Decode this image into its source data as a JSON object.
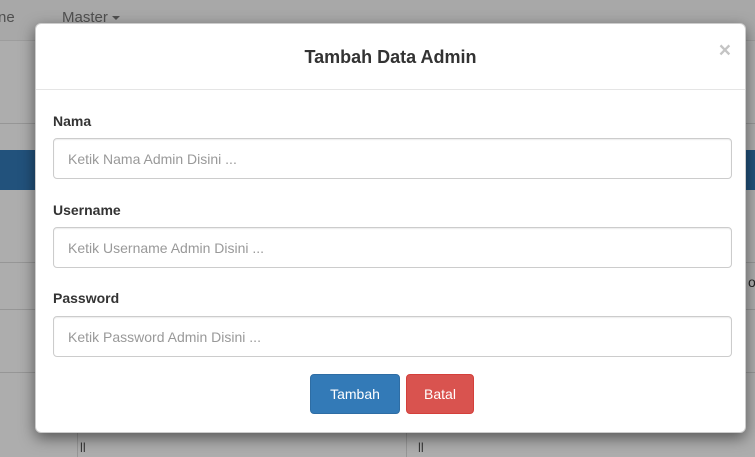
{
  "background": {
    "nav_fragment": "ne",
    "nav_master": "Master",
    "table_cell_1": "ll",
    "table_cell_2": "ll",
    "edge_fragment": "o"
  },
  "modal": {
    "title": "Tambah Data Admin",
    "close": "×",
    "fields": {
      "nama": {
        "label": "Nama",
        "placeholder": "Ketik Nama Admin Disini ...",
        "value": ""
      },
      "username": {
        "label": "Username",
        "placeholder": "Ketik Username Admin Disini ...",
        "value": ""
      },
      "password": {
        "label": "Password",
        "placeholder": "Ketik Password Admin Disini ...",
        "value": ""
      }
    },
    "buttons": {
      "submit": "Tambah",
      "cancel": "Batal"
    }
  },
  "colors": {
    "primary": "#337ab7",
    "danger": "#d9534f"
  }
}
